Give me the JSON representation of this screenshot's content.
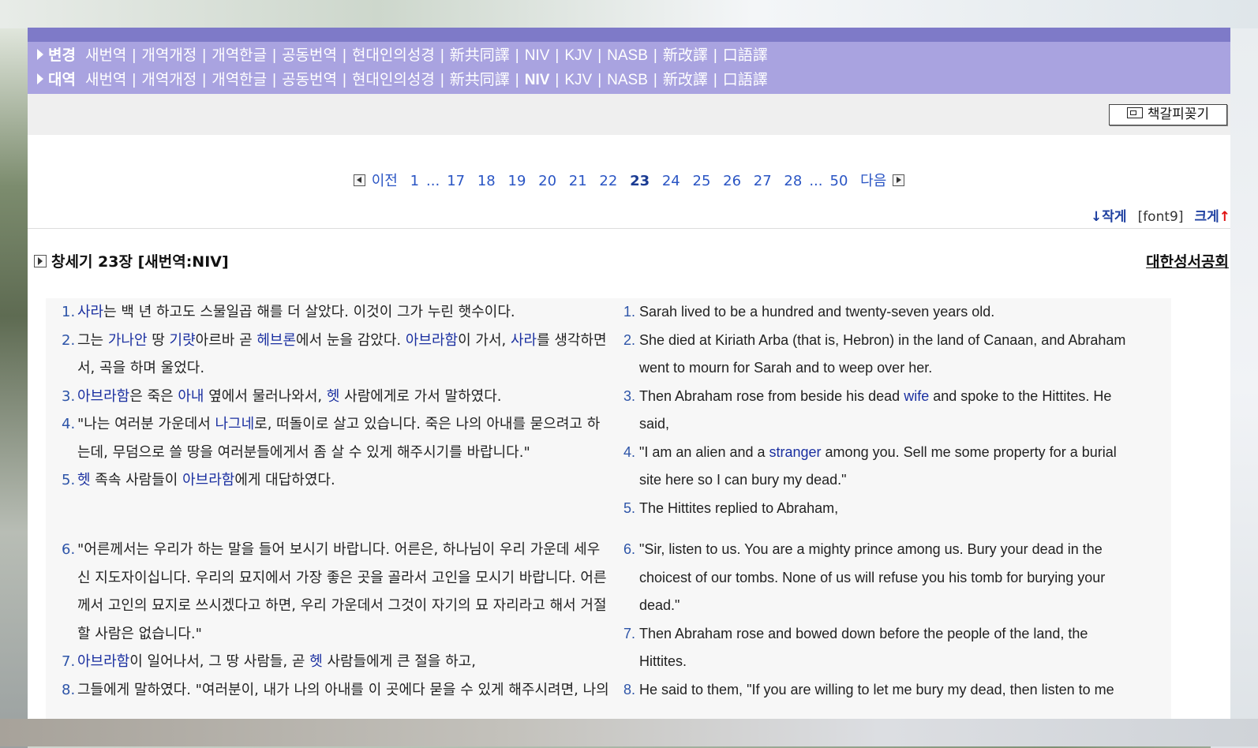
{
  "nav": {
    "row1": {
      "label": "변경",
      "items": [
        "새번역",
        "개역개정",
        "개역한글",
        "공동번역",
        "현대인의성경",
        "新共同譯",
        "NIV",
        "KJV",
        "NASB",
        "新改譯",
        "口語譯"
      ]
    },
    "row2": {
      "label": "대역",
      "items": [
        "새번역",
        "개역개정",
        "개역한글",
        "공동번역",
        "현대인의성경",
        "新共同譯",
        "NIV",
        "KJV",
        "NASB",
        "新改譯",
        "口語譯"
      ]
    }
  },
  "toolbar": {
    "bookmark_label": "책갈피꽂기"
  },
  "pager": {
    "prev": "이전",
    "first": "1",
    "dots": "...",
    "pages": [
      "17",
      "18",
      "19",
      "20",
      "21",
      "22",
      "23",
      "24",
      "25",
      "26",
      "27",
      "28"
    ],
    "current": "23",
    "last": "50",
    "next": "다음"
  },
  "font_control": {
    "smaller": "↓작게",
    "current": "[font9]",
    "bigger": "크게",
    "bigger_arrow": "↑"
  },
  "chapter": {
    "title": "창세기 23장 [새번역:NIV]",
    "publisher": "대한성서공회"
  },
  "korean": {
    "v1": {
      "num": "1.",
      "a": "사라",
      "b": "는 백 년 하고도 스물일곱 해를 더 살았다. 이것이 그가 누린 햇수이다."
    },
    "v2": {
      "num": "2.",
      "a": "그는 ",
      "b": "가나안",
      "c": " 땅 ",
      "d": "기럇",
      "e": "아르바 곧 ",
      "f": "헤브론",
      "g": "에서 눈을 감았다. ",
      "h": "아브라함",
      "i": "이 가서, ",
      "j": "사라",
      "k": "를 생각하면",
      "l": "서, 곡을 하며 울었다."
    },
    "v3": {
      "num": "3.",
      "a": "아브라함",
      "b": "은 죽은 ",
      "c": "아내",
      "d": " 옆에서 물러나와서, ",
      "e": "헷",
      "f": " 사람에게로 가서 말하였다."
    },
    "v4": {
      "num": "4.",
      "a": "\"나는 여러분 가운데서 ",
      "b": "나그네",
      "c": "로, 떠돌이로 살고 있습니다. 죽은 나의 아내를 묻으려고 하",
      "d": "는데, 무덤으로 쓸 땅을 여러분들에게서 좀 살 수 있게 해주시기를 바랍니다.\""
    },
    "v5": {
      "num": "5.",
      "a": "헷",
      "b": " 족속 사람들이 ",
      "c": "아브라함",
      "d": "에게 대답하였다."
    },
    "v6": {
      "num": "6.",
      "l1": "\"어른께서는 우리가 하는 말을 들어 보시기 바랍니다. 어른은, 하나님이 우리 가운데 세우",
      "l2": "신 지도자이십니다. 우리의 묘지에서 가장 좋은 곳을 골라서 고인을 모시기 바랍니다. 어른",
      "l3": "께서 고인의 묘지로 쓰시겠다고 하면, 우리 가운데서 그것이 자기의 묘 자리라고 해서 거절",
      "l4": "할 사람은 없습니다.\""
    },
    "v7": {
      "num": "7.",
      "a": "아브라함",
      "b": "이 일어나서, 그 땅 사람들, 곧 ",
      "c": "헷",
      "d": " 사람들에게 큰 절을 하고,"
    },
    "v8": {
      "num": "8.",
      "a": "그들에게 말하였다. \"여러분이, 내가 나의 아내를 이 곳에다 묻을 수 있게 해주시려면, 나의"
    }
  },
  "english": {
    "v1": {
      "num": "1.",
      "a": "Sarah lived to be a hundred and twenty-seven years old."
    },
    "v2": {
      "num": "2.",
      "l1": "She died at Kiriath Arba (that is, Hebron) in the land of Canaan, and Abraham",
      "l2": "went to mourn for Sarah and to weep over her."
    },
    "v3": {
      "num": "3.",
      "a": "Then Abraham rose from beside his dead ",
      "b": "wife",
      "c": " and spoke to the Hittites. He",
      "d": "said,"
    },
    "v4": {
      "num": "4.",
      "a": "\"I am an alien and a ",
      "b": "stranger",
      "c": " among you. Sell me some property for a burial",
      "d": "site here so I can bury my dead.\""
    },
    "v5": {
      "num": "5.",
      "a": "The Hittites replied to Abraham,"
    },
    "v6": {
      "num": "6.",
      "l1": "\"Sir, listen to us. You are a mighty prince among us. Bury your dead in the",
      "l2": "choicest of our tombs. None of us will refuse you his tomb for burying your",
      "l3": "dead.\""
    },
    "v7": {
      "num": "7.",
      "l1": "Then Abraham rose and bowed down before the people of the land, the",
      "l2": "Hittites."
    },
    "v8": {
      "num": "8.",
      "a": "He said to them, \"If you are willing to let me bury my dead, then listen to me"
    }
  }
}
